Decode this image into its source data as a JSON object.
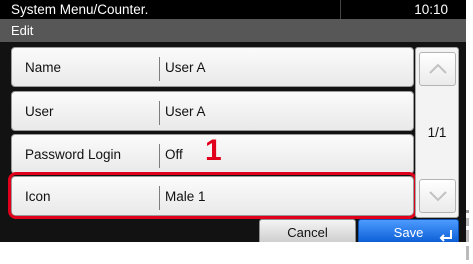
{
  "titlebar": {
    "title": "System Menu/Counter.",
    "time": "10:10"
  },
  "subtitle": "Edit",
  "rows": [
    {
      "label": "Name",
      "value": "User A"
    },
    {
      "label": "User",
      "value": "User A"
    },
    {
      "label": "Password Login",
      "value": "Off"
    },
    {
      "label": "Icon",
      "value": "Male 1"
    }
  ],
  "callout": "1",
  "scroll": {
    "page": "1/1",
    "up_icon": "chevron-up-icon",
    "down_icon": "chevron-down-icon"
  },
  "footer": {
    "cancel_label": "Cancel",
    "save_label": "Save",
    "save_icon": "enter-icon"
  },
  "colors": {
    "highlight": "#e0001b",
    "save_button": "#1a6fe0",
    "title_bar": "#000000",
    "subtitle_bar": "#575757"
  }
}
